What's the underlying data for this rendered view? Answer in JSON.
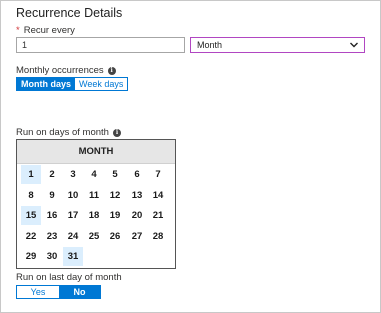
{
  "section_title": "Recurrence Details",
  "recur_every": {
    "label": "Recur every",
    "value": "1",
    "unit": "Month"
  },
  "monthly_occurrences": {
    "label": "Monthly occurrences",
    "options": [
      "Month days",
      "Week days"
    ],
    "selected": "Month days"
  },
  "run_on_days": {
    "label": "Run on days of month",
    "calendar_header": "MONTH",
    "days": [
      "1",
      "2",
      "3",
      "4",
      "5",
      "6",
      "7",
      "8",
      "9",
      "10",
      "11",
      "12",
      "13",
      "14",
      "15",
      "16",
      "17",
      "18",
      "19",
      "20",
      "21",
      "22",
      "23",
      "24",
      "25",
      "26",
      "27",
      "28",
      "29",
      "30",
      "31"
    ],
    "selected_days": [
      "1",
      "15",
      "31"
    ]
  },
  "run_on_last_day": {
    "label": "Run on last day of month",
    "options": [
      "Yes",
      "No"
    ],
    "selected": "No"
  },
  "colors": {
    "accent": "#0078d4",
    "select_border": "#b146c2",
    "selected_day_bg": "#dbeefd",
    "required": "#d13438"
  },
  "icons": {
    "info": "info-icon",
    "dropdown": "chevron-down-icon"
  }
}
